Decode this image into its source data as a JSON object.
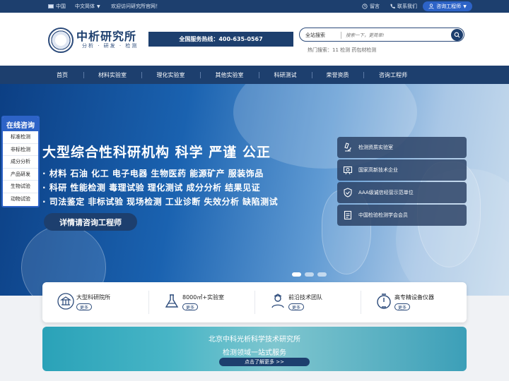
{
  "topbar": {
    "region": "中国",
    "language": "中文简体",
    "welcome": "欢迎访问研究所官网！",
    "message": "留言",
    "contact": "联系我们",
    "engineer_button": "咨询工程师"
  },
  "header": {
    "logo_title": "中析研究所",
    "logo_subtitle": "分析 · 研发 · 检测",
    "hotline": "全国服务热线：400-635-0567",
    "search_label": "全站搜索",
    "search_placeholder": "搜索一下，更简单!",
    "hot_search": "热门搜索：11 检测 药包材检测"
  },
  "nav": {
    "items": [
      "首页",
      "材料实验室",
      "理化实验室",
      "其他实验室",
      "科研测试",
      "荣誉资质",
      "咨询工程师"
    ]
  },
  "hero": {
    "title": "大型综合性科研机构  科学  严谨  公正",
    "line1": "· 材料  石油  化工  电子电器  生物医药  能源矿产  服装饰品",
    "line2": "· 科研  性能检测  毒理试验  理化测试  成分分析  结果见证",
    "line3": "· 司法鉴定  非标试验  现场检测  工业诊断  失效分析  缺陷测试",
    "cta": "详情请咨询工程师",
    "badges": [
      "检测资质实验室",
      "国家高新技术企业",
      "AAA级诚信经营示范单位",
      "中国检验检测学会会员"
    ],
    "slides": 3,
    "active_slide": 1
  },
  "sidebar": {
    "title": "在线咨询",
    "items": [
      "标准检测",
      "非标检测",
      "成分分析",
      "产品研发",
      "生物试验",
      "动物试验"
    ]
  },
  "features": {
    "items": [
      {
        "label": "大型科研院所",
        "more": "更多",
        "icon": "building-icon"
      },
      {
        "label": "8000㎡+实验室",
        "more": "更多",
        "icon": "flask-icon"
      },
      {
        "label": "前沿技术团队",
        "more": "更多",
        "icon": "team-icon"
      },
      {
        "label": "高专精设备仪器",
        "more": "更多",
        "icon": "gauge-icon"
      }
    ]
  },
  "promo": {
    "line1": "北京中科光析科学技术研究所",
    "line2": "检测领域一站式服务",
    "button": "点击了解更多 >>"
  },
  "colors": {
    "primary": "#1d3f6e",
    "accent": "#2d63c7",
    "promo": "#47b5c6"
  }
}
